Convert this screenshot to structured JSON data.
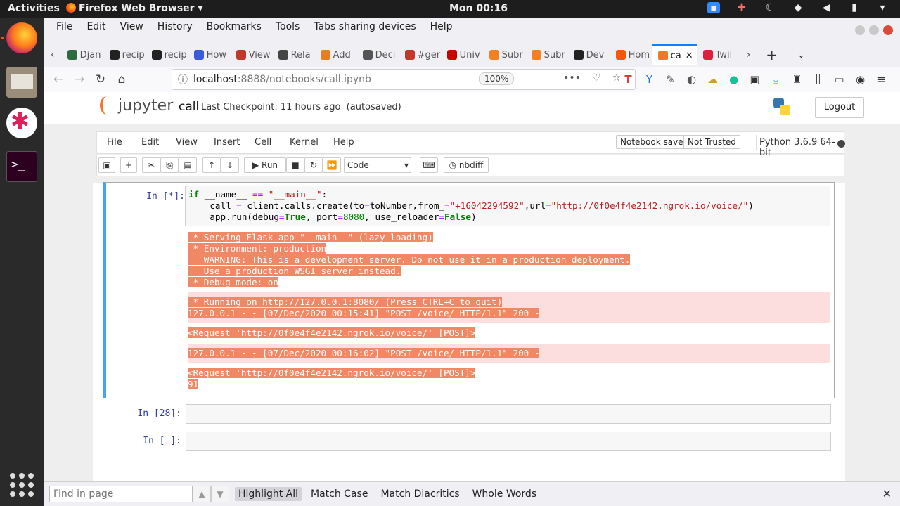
{
  "system": {
    "activities": "Activities",
    "app_name": "Firefox Web Browser",
    "clock": "Mon 00:16"
  },
  "browser": {
    "menu": [
      "File",
      "Edit",
      "View",
      "History",
      "Bookmarks",
      "Tools",
      "Tabs sharing devices",
      "Help"
    ],
    "tabs": [
      {
        "label": "Djan",
        "color": "#2b6b3f"
      },
      {
        "label": "recip",
        "color": "#222222"
      },
      {
        "label": "recip",
        "color": "#222222"
      },
      {
        "label": "How",
        "color": "#3b5bdb"
      },
      {
        "label": "View",
        "color": "#c0392b"
      },
      {
        "label": "Rela",
        "color": "#444444"
      },
      {
        "label": "Add",
        "color": "#e67e22"
      },
      {
        "label": "Deci",
        "color": "#555555"
      },
      {
        "label": "#ger",
        "color": "#c0392b"
      },
      {
        "label": "Univ",
        "color": "#cc0000"
      },
      {
        "label": "Subr",
        "color": "#f48024"
      },
      {
        "label": "Subr",
        "color": "#f48024"
      },
      {
        "label": "Dev",
        "color": "#222222"
      },
      {
        "label": "Hom",
        "color": "#ff5500"
      },
      {
        "label": "ca",
        "color": "#f37726",
        "active": true
      },
      {
        "label": "Twil",
        "color": "#e31e3d"
      }
    ],
    "url_host": "localhost",
    "url_path": ":8888/notebooks/call.ipynb",
    "zoom": "100%"
  },
  "jupyter": {
    "logo_text": "jupyter",
    "notebook_name": "call",
    "checkpoint": "Last Checkpoint: 11 hours ago",
    "autosave": "(autosaved)",
    "logout": "Logout",
    "menu": [
      "File",
      "Edit",
      "View",
      "Insert",
      "Cell",
      "Kernel",
      "Help"
    ],
    "notebook_saved": "Notebook saved",
    "not_trusted": "Not Trusted",
    "kernel": "Python 3.6.9 64-bit",
    "toolbar": {
      "run": "Run",
      "cell_type": "Code",
      "nbdiff": "nbdiff"
    }
  },
  "cells": [
    {
      "prompt": "In [*]:",
      "code_lines": [
        "if __name__ == \"__main__\":",
        "    call = client.calls.create(to=toNumber,from_=\"+16042294592\",url=\"http://0f0e4f4e2142.ngrok.io/voice/\")",
        "    app.run(debug=True, port=8080, use_reloader=False)"
      ],
      "output_stdout_1": [
        " * Serving Flask app \"__main__\" (lazy loading)",
        " * Environment: production",
        "   WARNING: This is a development server. Do not use it in a production deployment.",
        "   Use a production WSGI server instead.",
        " * Debug mode: on"
      ],
      "output_stderr_1": [
        " * Running on http://127.0.0.1:8080/ (Press CTRL+C to quit)",
        "127.0.0.1 - - [07/Dec/2020 00:15:41] \"POST /voice/ HTTP/1.1\" 200 -"
      ],
      "output_stdout_2": [
        "<Request 'http://0f0e4f4e2142.ngrok.io/voice/' [POST]>"
      ],
      "output_stderr_2": [
        "127.0.0.1 - - [07/Dec/2020 00:16:02] \"POST /voice/ HTTP/1.1\" 200 -"
      ],
      "output_stdout_3": [
        "<Request 'http://0f0e4f4e2142.ngrok.io/voice/' [POST]>",
        "91"
      ]
    },
    {
      "prompt": "In [28]:"
    },
    {
      "prompt": "In [ ]:"
    }
  ],
  "findbar": {
    "placeholder": "Find in page",
    "highlight_all": "Highlight All",
    "match_case": "Match Case",
    "match_diacritics": "Match Diacritics",
    "whole_words": "Whole Words"
  }
}
